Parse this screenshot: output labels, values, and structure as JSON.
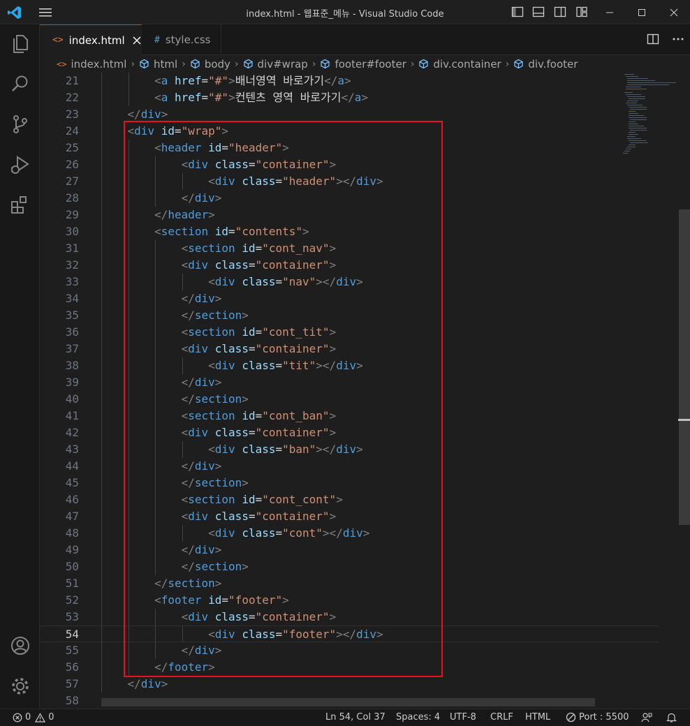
{
  "window": {
    "title": "index.html - 웹표준_메뉴 - Visual Studio Code"
  },
  "tabs": [
    {
      "icon": "<>",
      "label": "index.html",
      "active": true
    },
    {
      "icon": "#",
      "label": "style.css",
      "active": false
    }
  ],
  "breadcrumb": [
    "index.html",
    "html",
    "body",
    "div#wrap",
    "footer#footer",
    "div.container",
    "div.footer"
  ],
  "editor": {
    "current_line": 54,
    "lines": [
      {
        "n": "21",
        "t": [
          [
            "txt",
            "        "
          ],
          [
            "brk",
            "<"
          ],
          [
            "tag",
            "a"
          ],
          [
            "txt",
            " "
          ],
          [
            "attr",
            "href"
          ],
          [
            "txt",
            "="
          ],
          [
            "str",
            "\"#\""
          ],
          [
            "brk",
            ">"
          ],
          [
            "txt",
            "배너영역 바로가기"
          ],
          [
            "brk",
            "</"
          ],
          [
            "tag",
            "a"
          ],
          [
            "brk",
            ">"
          ]
        ]
      },
      {
        "n": "22",
        "t": [
          [
            "txt",
            "        "
          ],
          [
            "brk",
            "<"
          ],
          [
            "tag",
            "a"
          ],
          [
            "txt",
            " "
          ],
          [
            "attr",
            "href"
          ],
          [
            "txt",
            "="
          ],
          [
            "str",
            "\"#\""
          ],
          [
            "brk",
            ">"
          ],
          [
            "txt",
            "컨텐츠 영역 바로가기"
          ],
          [
            "brk",
            "</"
          ],
          [
            "tag",
            "a"
          ],
          [
            "brk",
            ">"
          ]
        ]
      },
      {
        "n": "23",
        "t": [
          [
            "txt",
            "    "
          ],
          [
            "brk",
            "</"
          ],
          [
            "tag",
            "div"
          ],
          [
            "brk",
            ">"
          ]
        ]
      },
      {
        "n": "24",
        "t": [
          [
            "txt",
            "    "
          ],
          [
            "brk",
            "<"
          ],
          [
            "tag",
            "div"
          ],
          [
            "txt",
            " "
          ],
          [
            "attr",
            "id"
          ],
          [
            "txt",
            "="
          ],
          [
            "str",
            "\"wrap\""
          ],
          [
            "brk",
            ">"
          ]
        ]
      },
      {
        "n": "25",
        "t": [
          [
            "txt",
            "        "
          ],
          [
            "brk",
            "<"
          ],
          [
            "tag",
            "header"
          ],
          [
            "txt",
            " "
          ],
          [
            "attr",
            "id"
          ],
          [
            "txt",
            "="
          ],
          [
            "str",
            "\"header\""
          ],
          [
            "brk",
            ">"
          ]
        ]
      },
      {
        "n": "26",
        "t": [
          [
            "txt",
            "            "
          ],
          [
            "brk",
            "<"
          ],
          [
            "tag",
            "div"
          ],
          [
            "txt",
            " "
          ],
          [
            "attr",
            "class"
          ],
          [
            "txt",
            "="
          ],
          [
            "str",
            "\"container\""
          ],
          [
            "brk",
            ">"
          ]
        ]
      },
      {
        "n": "27",
        "t": [
          [
            "txt",
            "                "
          ],
          [
            "brk",
            "<"
          ],
          [
            "tag",
            "div"
          ],
          [
            "txt",
            " "
          ],
          [
            "attr",
            "class"
          ],
          [
            "txt",
            "="
          ],
          [
            "str",
            "\"header\""
          ],
          [
            "brk",
            "></"
          ],
          [
            "tag",
            "div"
          ],
          [
            "brk",
            ">"
          ]
        ]
      },
      {
        "n": "28",
        "t": [
          [
            "txt",
            "            "
          ],
          [
            "brk",
            "</"
          ],
          [
            "tag",
            "div"
          ],
          [
            "brk",
            ">"
          ]
        ]
      },
      {
        "n": "29",
        "t": [
          [
            "txt",
            "        "
          ],
          [
            "brk",
            "</"
          ],
          [
            "tag",
            "header"
          ],
          [
            "brk",
            ">"
          ]
        ]
      },
      {
        "n": "30",
        "t": [
          [
            "txt",
            "        "
          ],
          [
            "brk",
            "<"
          ],
          [
            "tag",
            "section"
          ],
          [
            "txt",
            " "
          ],
          [
            "attr",
            "id"
          ],
          [
            "txt",
            "="
          ],
          [
            "str",
            "\"contents\""
          ],
          [
            "brk",
            ">"
          ]
        ]
      },
      {
        "n": "31",
        "t": [
          [
            "txt",
            "            "
          ],
          [
            "brk",
            "<"
          ],
          [
            "tag",
            "section"
          ],
          [
            "txt",
            " "
          ],
          [
            "attr",
            "id"
          ],
          [
            "txt",
            "="
          ],
          [
            "str",
            "\"cont_nav\""
          ],
          [
            "brk",
            ">"
          ]
        ]
      },
      {
        "n": "32",
        "t": [
          [
            "txt",
            "            "
          ],
          [
            "brk",
            "<"
          ],
          [
            "tag",
            "div"
          ],
          [
            "txt",
            " "
          ],
          [
            "attr",
            "class"
          ],
          [
            "txt",
            "="
          ],
          [
            "str",
            "\"container\""
          ],
          [
            "brk",
            ">"
          ]
        ]
      },
      {
        "n": "33",
        "t": [
          [
            "txt",
            "                "
          ],
          [
            "brk",
            "<"
          ],
          [
            "tag",
            "div"
          ],
          [
            "txt",
            " "
          ],
          [
            "attr",
            "class"
          ],
          [
            "txt",
            "="
          ],
          [
            "str",
            "\"nav\""
          ],
          [
            "brk",
            "></"
          ],
          [
            "tag",
            "div"
          ],
          [
            "brk",
            ">"
          ]
        ]
      },
      {
        "n": "34",
        "t": [
          [
            "txt",
            "            "
          ],
          [
            "brk",
            "</"
          ],
          [
            "tag",
            "div"
          ],
          [
            "brk",
            ">"
          ]
        ]
      },
      {
        "n": "35",
        "t": [
          [
            "txt",
            "            "
          ],
          [
            "brk",
            "</"
          ],
          [
            "tag",
            "section"
          ],
          [
            "brk",
            ">"
          ]
        ]
      },
      {
        "n": "36",
        "t": [
          [
            "txt",
            "            "
          ],
          [
            "brk",
            "<"
          ],
          [
            "tag",
            "section"
          ],
          [
            "txt",
            " "
          ],
          [
            "attr",
            "id"
          ],
          [
            "txt",
            "="
          ],
          [
            "str",
            "\"cont_tit\""
          ],
          [
            "brk",
            ">"
          ]
        ]
      },
      {
        "n": "37",
        "t": [
          [
            "txt",
            "            "
          ],
          [
            "brk",
            "<"
          ],
          [
            "tag",
            "div"
          ],
          [
            "txt",
            " "
          ],
          [
            "attr",
            "class"
          ],
          [
            "txt",
            "="
          ],
          [
            "str",
            "\"container\""
          ],
          [
            "brk",
            ">"
          ]
        ]
      },
      {
        "n": "38",
        "t": [
          [
            "txt",
            "                "
          ],
          [
            "brk",
            "<"
          ],
          [
            "tag",
            "div"
          ],
          [
            "txt",
            " "
          ],
          [
            "attr",
            "class"
          ],
          [
            "txt",
            "="
          ],
          [
            "str",
            "\"tit\""
          ],
          [
            "brk",
            "></"
          ],
          [
            "tag",
            "div"
          ],
          [
            "brk",
            ">"
          ]
        ]
      },
      {
        "n": "39",
        "t": [
          [
            "txt",
            "            "
          ],
          [
            "brk",
            "</"
          ],
          [
            "tag",
            "div"
          ],
          [
            "brk",
            ">"
          ]
        ]
      },
      {
        "n": "40",
        "t": [
          [
            "txt",
            "            "
          ],
          [
            "brk",
            "</"
          ],
          [
            "tag",
            "section"
          ],
          [
            "brk",
            ">"
          ]
        ]
      },
      {
        "n": "41",
        "t": [
          [
            "txt",
            "            "
          ],
          [
            "brk",
            "<"
          ],
          [
            "tag",
            "section"
          ],
          [
            "txt",
            " "
          ],
          [
            "attr",
            "id"
          ],
          [
            "txt",
            "="
          ],
          [
            "str",
            "\"cont_ban\""
          ],
          [
            "brk",
            ">"
          ]
        ]
      },
      {
        "n": "42",
        "t": [
          [
            "txt",
            "            "
          ],
          [
            "brk",
            "<"
          ],
          [
            "tag",
            "div"
          ],
          [
            "txt",
            " "
          ],
          [
            "attr",
            "class"
          ],
          [
            "txt",
            "="
          ],
          [
            "str",
            "\"container\""
          ],
          [
            "brk",
            ">"
          ]
        ]
      },
      {
        "n": "43",
        "t": [
          [
            "txt",
            "                "
          ],
          [
            "brk",
            "<"
          ],
          [
            "tag",
            "div"
          ],
          [
            "txt",
            " "
          ],
          [
            "attr",
            "class"
          ],
          [
            "txt",
            "="
          ],
          [
            "str",
            "\"ban\""
          ],
          [
            "brk",
            "></"
          ],
          [
            "tag",
            "div"
          ],
          [
            "brk",
            ">"
          ]
        ]
      },
      {
        "n": "44",
        "t": [
          [
            "txt",
            "            "
          ],
          [
            "brk",
            "</"
          ],
          [
            "tag",
            "div"
          ],
          [
            "brk",
            ">"
          ]
        ]
      },
      {
        "n": "45",
        "t": [
          [
            "txt",
            "            "
          ],
          [
            "brk",
            "</"
          ],
          [
            "tag",
            "section"
          ],
          [
            "brk",
            ">"
          ]
        ]
      },
      {
        "n": "46",
        "t": [
          [
            "txt",
            "            "
          ],
          [
            "brk",
            "<"
          ],
          [
            "tag",
            "section"
          ],
          [
            "txt",
            " "
          ],
          [
            "attr",
            "id"
          ],
          [
            "txt",
            "="
          ],
          [
            "str",
            "\"cont_cont\""
          ],
          [
            "brk",
            ">"
          ]
        ]
      },
      {
        "n": "47",
        "t": [
          [
            "txt",
            "            "
          ],
          [
            "brk",
            "<"
          ],
          [
            "tag",
            "div"
          ],
          [
            "txt",
            " "
          ],
          [
            "attr",
            "class"
          ],
          [
            "txt",
            "="
          ],
          [
            "str",
            "\"container\""
          ],
          [
            "brk",
            ">"
          ]
        ]
      },
      {
        "n": "48",
        "t": [
          [
            "txt",
            "                "
          ],
          [
            "brk",
            "<"
          ],
          [
            "tag",
            "div"
          ],
          [
            "txt",
            " "
          ],
          [
            "attr",
            "class"
          ],
          [
            "txt",
            "="
          ],
          [
            "str",
            "\"cont\""
          ],
          [
            "brk",
            "></"
          ],
          [
            "tag",
            "div"
          ],
          [
            "brk",
            ">"
          ]
        ]
      },
      {
        "n": "49",
        "t": [
          [
            "txt",
            "            "
          ],
          [
            "brk",
            "</"
          ],
          [
            "tag",
            "div"
          ],
          [
            "brk",
            ">"
          ]
        ]
      },
      {
        "n": "50",
        "t": [
          [
            "txt",
            "            "
          ],
          [
            "brk",
            "</"
          ],
          [
            "tag",
            "section"
          ],
          [
            "brk",
            ">"
          ]
        ]
      },
      {
        "n": "51",
        "t": [
          [
            "txt",
            "        "
          ],
          [
            "brk",
            "</"
          ],
          [
            "tag",
            "section"
          ],
          [
            "brk",
            ">"
          ]
        ]
      },
      {
        "n": "52",
        "t": [
          [
            "txt",
            "        "
          ],
          [
            "brk",
            "<"
          ],
          [
            "tag",
            "footer"
          ],
          [
            "txt",
            " "
          ],
          [
            "attr",
            "id"
          ],
          [
            "txt",
            "="
          ],
          [
            "str",
            "\"footer\""
          ],
          [
            "brk",
            ">"
          ]
        ]
      },
      {
        "n": "53",
        "t": [
          [
            "txt",
            "            "
          ],
          [
            "brk",
            "<"
          ],
          [
            "tag",
            "div"
          ],
          [
            "txt",
            " "
          ],
          [
            "attr",
            "class"
          ],
          [
            "txt",
            "="
          ],
          [
            "str",
            "\"container\""
          ],
          [
            "brk",
            ">"
          ]
        ]
      },
      {
        "n": "54",
        "t": [
          [
            "txt",
            "                "
          ],
          [
            "brk",
            "<"
          ],
          [
            "tag",
            "div"
          ],
          [
            "txt",
            " "
          ],
          [
            "attr",
            "class"
          ],
          [
            "txt",
            "="
          ],
          [
            "str",
            "\"footer\""
          ],
          [
            "brk",
            "></"
          ],
          [
            "tag",
            "div"
          ],
          [
            "brk",
            ">"
          ]
        ]
      },
      {
        "n": "55",
        "t": [
          [
            "txt",
            "            "
          ],
          [
            "brk",
            "</"
          ],
          [
            "tag",
            "div"
          ],
          [
            "brk",
            ">"
          ]
        ]
      },
      {
        "n": "56",
        "t": [
          [
            "txt",
            "        "
          ],
          [
            "brk",
            "</"
          ],
          [
            "tag",
            "footer"
          ],
          [
            "brk",
            ">"
          ]
        ]
      },
      {
        "n": "57",
        "t": [
          [
            "txt",
            "    "
          ],
          [
            "brk",
            "</"
          ],
          [
            "tag",
            "div"
          ],
          [
            "brk",
            ">"
          ]
        ]
      },
      {
        "n": "58",
        "t": []
      }
    ]
  },
  "status": {
    "errors": "0",
    "warnings": "0",
    "position": "Ln 54, Col 37",
    "spaces": "Spaces: 4",
    "encoding": "UTF-8",
    "eol": "CRLF",
    "language": "HTML",
    "port": "Port : 5500"
  },
  "colors": {
    "accent": "#0078d4",
    "highlight_box": "#e81123",
    "tag": "#569cd6",
    "attribute": "#9cdcfe",
    "string": "#ce9178"
  }
}
